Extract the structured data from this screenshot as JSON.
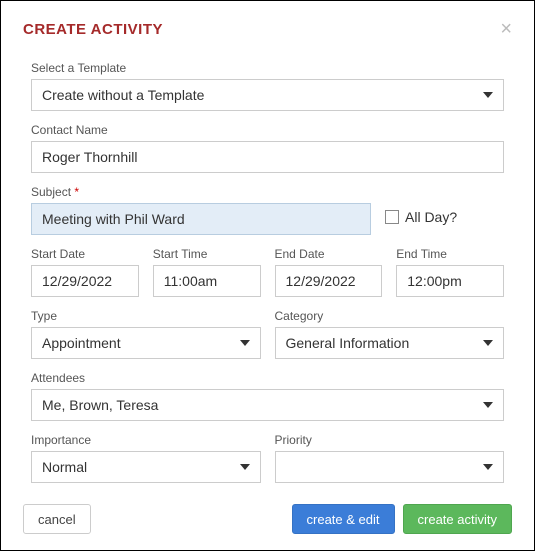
{
  "header": {
    "title": "CREATE ACTIVITY"
  },
  "template": {
    "label": "Select a Template",
    "value": "Create without a Template"
  },
  "contact": {
    "label": "Contact Name",
    "value": "Roger Thornhill"
  },
  "subject": {
    "label": "Subject",
    "required_mark": "*",
    "value": "Meeting with Phil Ward"
  },
  "allday": {
    "label": "All Day?"
  },
  "start_date": {
    "label": "Start Date",
    "value": "12/29/2022"
  },
  "start_time": {
    "label": "Start Time",
    "value": "11:00am"
  },
  "end_date": {
    "label": "End Date",
    "value": "12/29/2022"
  },
  "end_time": {
    "label": "End Time",
    "value": "12:00pm"
  },
  "type": {
    "label": "Type",
    "value": "Appointment"
  },
  "category": {
    "label": "Category",
    "value": "General Information"
  },
  "attendees": {
    "label": "Attendees",
    "value": "Me, Brown, Teresa"
  },
  "importance": {
    "label": "Importance",
    "value": "Normal"
  },
  "priority": {
    "label": "Priority",
    "value": ""
  },
  "buttons": {
    "cancel": "cancel",
    "create_edit": "create & edit",
    "create": "create activity"
  }
}
